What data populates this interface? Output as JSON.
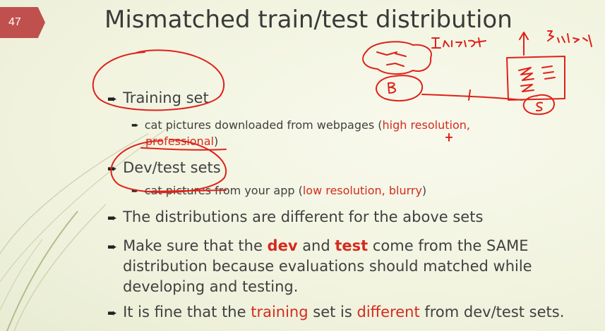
{
  "slide": {
    "number": "47",
    "title": "Mismatched train/test distribution"
  },
  "bullets": {
    "training_set": "Training set",
    "training_sub": {
      "before": "cat pictures downloaded from webpages (",
      "highlight_1": "high resolution,",
      "highlight_2": "professional",
      "after": ")"
    },
    "devtest_set": "Dev/test sets",
    "devtest_sub": {
      "before": "cat pictures from your app (",
      "highlight": "low resolution, blurry",
      "after": ")"
    },
    "distributions": "The distributions are different for the above sets",
    "make_sure": {
      "p1": "Make sure that the ",
      "dev": "dev",
      "p2": " and ",
      "test": "test",
      "p3": " come from the SAME",
      "line2": "distribution because evaluations should matched while",
      "line3": "developing and testing."
    },
    "fine": {
      "p1": "It is fine that the ",
      "training": "training",
      "p2": " set is ",
      "different": "different",
      "p3": " from dev/test sets."
    }
  },
  "colors": {
    "accent": "#c0504d",
    "highlight_text": "#d42b1e",
    "ink": "#e0201a"
  },
  "icons": {
    "bullet": "right-arrow-bullet-icon"
  }
}
